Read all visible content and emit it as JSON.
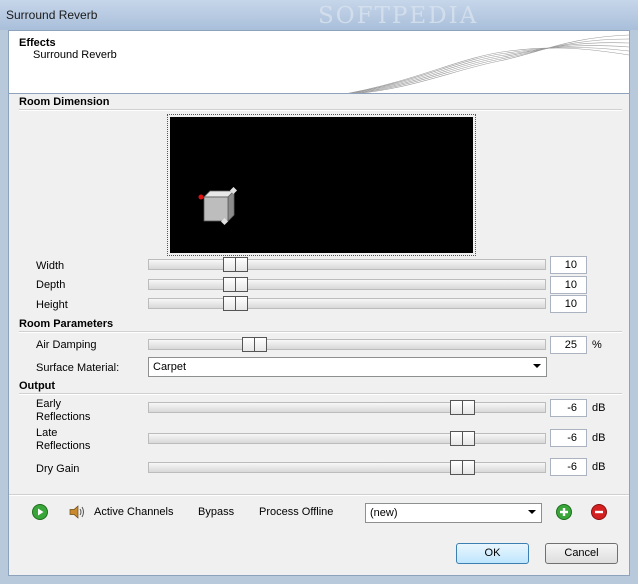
{
  "window": {
    "title": "Surround Reverb",
    "watermark": "SOFTPEDIA"
  },
  "header": {
    "heading": "Effects",
    "subheading": "Surround Reverb"
  },
  "room_dimension": {
    "section_label": "Room Dimension",
    "params": [
      {
        "label": "Width",
        "value": "10",
        "level": 0.2
      },
      {
        "label": "Depth",
        "value": "10",
        "level": 0.2
      },
      {
        "label": "Height",
        "value": "10",
        "level": 0.2
      }
    ]
  },
  "room_parameters": {
    "section_label": "Room Parameters",
    "air_damping": {
      "label": "Air Damping",
      "value": "25",
      "unit": "%",
      "level": 0.25
    },
    "surface_material": {
      "label": "Surface Material:",
      "value": "Carpet"
    }
  },
  "output": {
    "section_label": "Output",
    "params": [
      {
        "label_line1": "Early",
        "label_line2": "Reflections",
        "value": "-6",
        "unit": "dB",
        "level": 0.81
      },
      {
        "label_line1": "Late",
        "label_line2": "Reflections",
        "value": "-6",
        "unit": "dB",
        "level": 0.81
      },
      {
        "label_line1": "Dry Gain",
        "label_line2": "",
        "value": "-6",
        "unit": "dB",
        "level": 0.81
      }
    ]
  },
  "toolbar": {
    "active_channels": "Active Channels",
    "bypass": "Bypass",
    "process_offline": "Process Offline",
    "preset": "(new)"
  },
  "buttons": {
    "ok": "OK",
    "cancel": "Cancel"
  },
  "colors": {
    "play": "#3aa63a",
    "add": "#3aa63a",
    "remove": "#d42020",
    "room_marker": "#e01010"
  }
}
